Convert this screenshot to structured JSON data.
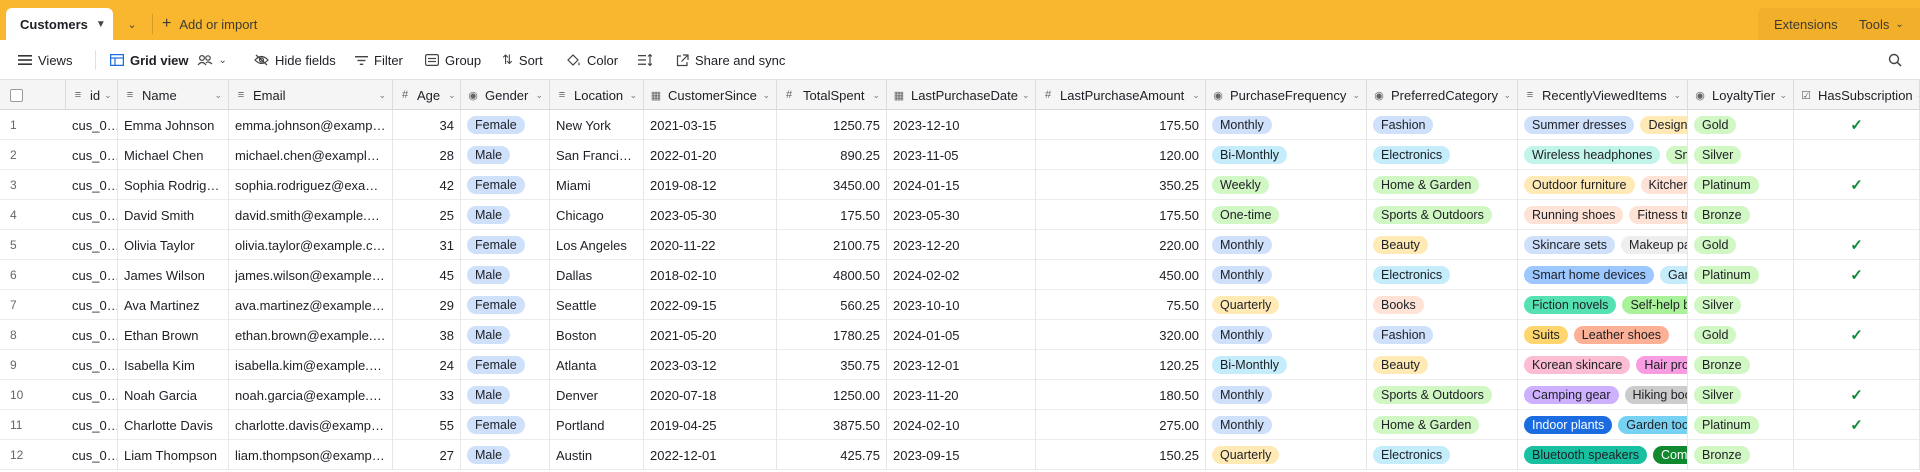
{
  "tabs": {
    "active": "Customers",
    "add_import": "Add or import",
    "extensions": "Extensions",
    "tools": "Tools"
  },
  "toolbar": {
    "views": "Views",
    "grid_view": "Grid view",
    "hide_fields": "Hide fields",
    "filter": "Filter",
    "group": "Group",
    "sort": "Sort",
    "color": "Color",
    "share_sync": "Share and sync"
  },
  "columns": [
    {
      "key": "id",
      "label": "id",
      "icon": "id-icon"
    },
    {
      "key": "name",
      "label": "Name",
      "icon": "text-icon"
    },
    {
      "key": "email",
      "label": "Email",
      "icon": "text-icon"
    },
    {
      "key": "age",
      "label": "Age",
      "icon": "number-icon"
    },
    {
      "key": "gender",
      "label": "Gender",
      "icon": "single-select-icon"
    },
    {
      "key": "location",
      "label": "Location",
      "icon": "text-icon"
    },
    {
      "key": "customer_since",
      "label": "CustomerSince",
      "icon": "date-icon"
    },
    {
      "key": "total_spent",
      "label": "TotalSpent",
      "icon": "number-icon"
    },
    {
      "key": "last_purchase_date",
      "label": "LastPurchaseDate",
      "icon": "date-icon"
    },
    {
      "key": "last_purchase_amount",
      "label": "LastPurchaseAmount",
      "icon": "number-icon"
    },
    {
      "key": "purchase_frequency",
      "label": "PurchaseFrequency",
      "icon": "single-select-icon"
    },
    {
      "key": "preferred_category",
      "label": "PreferredCategory",
      "icon": "single-select-icon"
    },
    {
      "key": "recently_viewed",
      "label": "RecentlyViewedItems",
      "icon": "multi-select-icon"
    },
    {
      "key": "loyalty_tier",
      "label": "LoyaltyTier",
      "icon": "single-select-icon"
    },
    {
      "key": "has_subscription",
      "label": "HasSubscription",
      "icon": "checkbox-icon"
    }
  ],
  "rows": [
    {
      "n": "1",
      "id": "cus_0…",
      "name": "Emma Johnson",
      "email": "emma.johnson@exampl…",
      "age": "34",
      "gender": "Female",
      "location": "New York",
      "since": "2021-03-15",
      "spent": "1250.75",
      "lpd": "2023-12-10",
      "lpa": "175.50",
      "freq": "Monthly",
      "cat": "Fashion",
      "viewed": [
        "Summer dresses",
        "Designe"
      ],
      "tier": "Gold",
      "sub": true
    },
    {
      "n": "2",
      "id": "cus_0…",
      "name": "Michael Chen",
      "email": "michael.chen@example.…",
      "age": "28",
      "gender": "Male",
      "location": "San Francisco",
      "since": "2022-01-20",
      "spent": "890.25",
      "lpd": "2023-11-05",
      "lpa": "120.00",
      "freq": "Bi-Monthly",
      "cat": "Electronics",
      "viewed": [
        "Wireless headphones",
        "Sm"
      ],
      "tier": "Silver",
      "sub": false
    },
    {
      "n": "3",
      "id": "cus_0…",
      "name": "Sophia Rodriguez",
      "email": "sophia.rodriguez@exam…",
      "age": "42",
      "gender": "Female",
      "location": "Miami",
      "since": "2019-08-12",
      "spent": "3450.00",
      "lpd": "2024-01-15",
      "lpa": "350.25",
      "freq": "Weekly",
      "cat": "Home & Garden",
      "viewed": [
        "Outdoor furniture",
        "Kitchen"
      ],
      "tier": "Platinum",
      "sub": true
    },
    {
      "n": "4",
      "id": "cus_0…",
      "name": "David Smith",
      "email": "david.smith@example.c…",
      "age": "25",
      "gender": "Male",
      "location": "Chicago",
      "since": "2023-05-30",
      "spent": "175.50",
      "lpd": "2023-05-30",
      "lpa": "175.50",
      "freq": "One-time",
      "cat": "Sports & Outdoors",
      "viewed": [
        "Running shoes",
        "Fitness tra"
      ],
      "tier": "Bronze",
      "sub": false
    },
    {
      "n": "5",
      "id": "cus_0…",
      "name": "Olivia Taylor",
      "email": "olivia.taylor@example.com",
      "age": "31",
      "gender": "Female",
      "location": "Los Angeles",
      "since": "2020-11-22",
      "spent": "2100.75",
      "lpd": "2023-12-20",
      "lpa": "220.00",
      "freq": "Monthly",
      "cat": "Beauty",
      "viewed": [
        "Skincare sets",
        "Makeup pa"
      ],
      "tier": "Gold",
      "sub": true
    },
    {
      "n": "6",
      "id": "cus_0…",
      "name": "James Wilson",
      "email": "james.wilson@example.c…",
      "age": "45",
      "gender": "Male",
      "location": "Dallas",
      "since": "2018-02-10",
      "spent": "4800.50",
      "lpd": "2024-02-02",
      "lpa": "450.00",
      "freq": "Monthly",
      "cat": "Electronics",
      "viewed": [
        "Smart home devices",
        "Gam"
      ],
      "tier": "Platinum",
      "sub": true
    },
    {
      "n": "7",
      "id": "cus_0…",
      "name": "Ava Martinez",
      "email": "ava.martinez@example.c…",
      "age": "29",
      "gender": "Female",
      "location": "Seattle",
      "since": "2022-09-15",
      "spent": "560.25",
      "lpd": "2023-10-10",
      "lpa": "75.50",
      "freq": "Quarterly",
      "cat": "Books",
      "viewed": [
        "Fiction novels",
        "Self-help b"
      ],
      "tier": "Silver",
      "sub": false
    },
    {
      "n": "8",
      "id": "cus_0…",
      "name": "Ethan Brown",
      "email": "ethan.brown@example.c…",
      "age": "38",
      "gender": "Male",
      "location": "Boston",
      "since": "2021-05-20",
      "spent": "1780.25",
      "lpd": "2024-01-05",
      "lpa": "320.00",
      "freq": "Monthly",
      "cat": "Fashion",
      "viewed": [
        "Suits",
        "Leather shoes"
      ],
      "tier": "Gold",
      "sub": true
    },
    {
      "n": "9",
      "id": "cus_0…",
      "name": "Isabella Kim",
      "email": "isabella.kim@example.c…",
      "age": "24",
      "gender": "Female",
      "location": "Atlanta",
      "since": "2023-03-12",
      "spent": "350.75",
      "lpd": "2023-12-01",
      "lpa": "120.25",
      "freq": "Bi-Monthly",
      "cat": "Beauty",
      "viewed": [
        "Korean skincare",
        "Hair proc"
      ],
      "tier": "Bronze",
      "sub": false
    },
    {
      "n": "10",
      "id": "cus_0…",
      "name": "Noah Garcia",
      "email": "noah.garcia@example.c…",
      "age": "33",
      "gender": "Male",
      "location": "Denver",
      "since": "2020-07-18",
      "spent": "1250.00",
      "lpd": "2023-11-20",
      "lpa": "180.50",
      "freq": "Monthly",
      "cat": "Sports & Outdoors",
      "viewed": [
        "Camping gear",
        "Hiking boo"
      ],
      "tier": "Silver",
      "sub": true
    },
    {
      "n": "11",
      "id": "cus_0…",
      "name": "Charlotte Davis",
      "email": "charlotte.davis@exampl…",
      "age": "55",
      "gender": "Female",
      "location": "Portland",
      "since": "2019-04-25",
      "spent": "3875.50",
      "lpd": "2024-02-10",
      "lpa": "275.00",
      "freq": "Monthly",
      "cat": "Home & Garden",
      "viewed": [
        "Indoor plants",
        "Garden too"
      ],
      "tier": "Platinum",
      "sub": true
    },
    {
      "n": "12",
      "id": "cus_0…",
      "name": "Liam Thompson",
      "email": "liam.thompson@exampl…",
      "age": "27",
      "gender": "Male",
      "location": "Austin",
      "since": "2022-12-01",
      "spent": "425.75",
      "lpd": "2023-09-15",
      "lpa": "150.25",
      "freq": "Quarterly",
      "cat": "Electronics",
      "viewed": [
        "Bluetooth speakers",
        "Comp"
      ],
      "tier": "Bronze",
      "sub": false
    }
  ],
  "colors": {
    "tabbar": "#f8b72e",
    "gender": {
      "Female": "#cfe0fb",
      "Male": "#cfe0fb"
    },
    "freq": {
      "Monthly": "#cfe0fb",
      "Bi-Monthly": "#c4ecfb",
      "Weekly": "#d1f7c4",
      "One-time": "#d1f7c4",
      "Quarterly": "#ffeab6"
    },
    "cat": {
      "Fashion": "#cfe0fb",
      "Electronics": "#c4ecfb",
      "Home & Garden": "#d1f7c4",
      "Sports & Outdoors": "#d1f7c4",
      "Beauty": "#ffeab6",
      "Books": "#fee2d5"
    },
    "tier": {
      "Gold": "#d1f7c4",
      "Silver": "#d1f7c4",
      "Platinum": "#d1f7c4",
      "Bronze": "#d1f7c4"
    },
    "viewed": [
      [
        "#cfe0fb",
        "#ffeab6"
      ],
      [
        "#c2f5e9",
        "#d1f7c4"
      ],
      [
        "#ffeab6",
        "#fee2d5"
      ],
      [
        "#fee2d5",
        "#fee2d5"
      ],
      [
        "#cfe0fb",
        "#eeeeee"
      ],
      [
        "#9cc7ff",
        "#c4ecfb"
      ],
      [
        "#56e1b3",
        "#aaf299"
      ],
      [
        "#ffd66e",
        "#fcb095"
      ],
      [
        "#fbbcd4",
        "#f99de2"
      ],
      [
        "#cdb0ff",
        "#cccccc"
      ],
      [
        "#1a6ce0",
        "#77d1f3"
      ],
      [
        "#18bfa0",
        "#11892e"
      ]
    ]
  }
}
